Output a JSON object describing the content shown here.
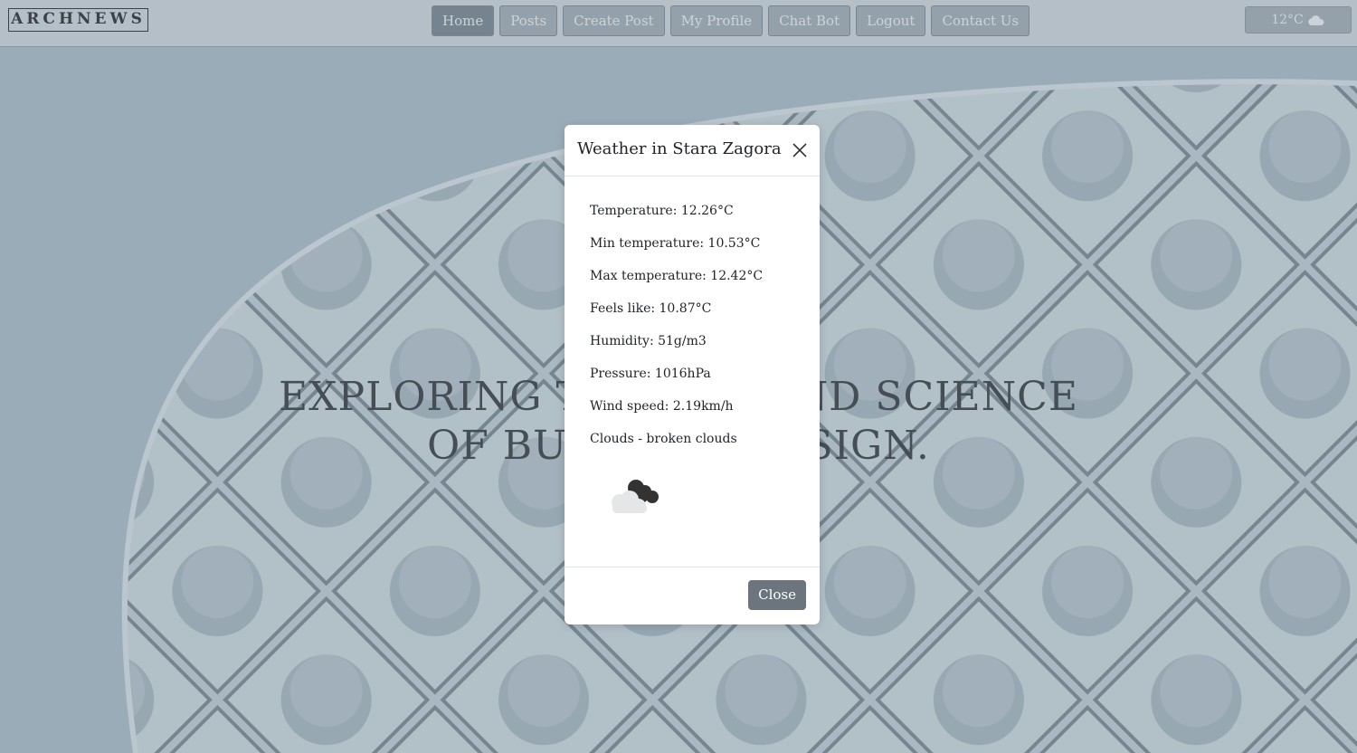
{
  "navbar": {
    "brand": "ARCHNEWS",
    "items": [
      {
        "label": "Home",
        "active": true
      },
      {
        "label": "Posts",
        "active": false
      },
      {
        "label": "Create Post",
        "active": false
      },
      {
        "label": "My Profile",
        "active": false
      },
      {
        "label": "Chat Bot",
        "active": false
      },
      {
        "label": "Logout",
        "active": false
      },
      {
        "label": "Contact Us",
        "active": false
      }
    ],
    "weather": {
      "temp": "12°C",
      "icon": "cloud-icon"
    }
  },
  "hero": {
    "line1": "EXPLORING THE ART AND SCIENCE",
    "line2": "OF BUILDING DESIGN."
  },
  "modal": {
    "title": "Weather in Stara Zagora",
    "lines": [
      "Temperature: 12.26°C",
      "Min temperature: 10.53°C",
      "Max temperature: 12.42°C",
      "Feels like: 10.87°C",
      "Humidity: 51g/m3",
      "Pressure: 1016hPa",
      "Wind speed: 2.19km/h",
      "Clouds - broken clouds"
    ],
    "icon": "broken-clouds-icon",
    "close_label": "Close"
  },
  "colors": {
    "navbar_bg": "#cfd7de",
    "nav_button": "#a4afb9",
    "close_button": "#6c757d"
  }
}
